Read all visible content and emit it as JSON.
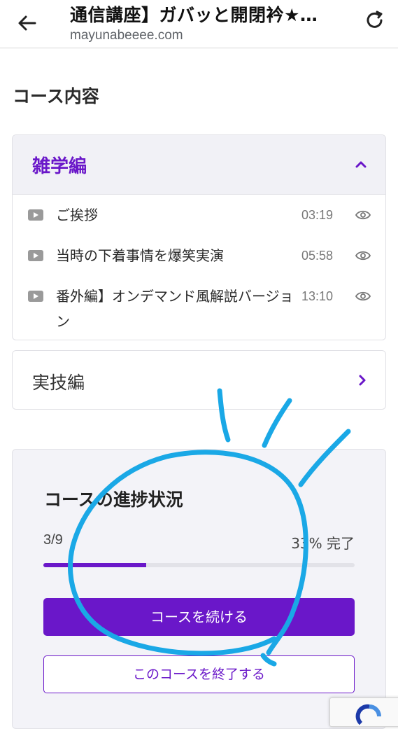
{
  "topbar": {
    "title": "通信講座】ガバッと開閉衿★…",
    "url": "mayunabeeee.com",
    "back_icon": "arrow-left-icon",
    "reload_icon": "reload-icon"
  },
  "content": {
    "heading": "コース内容",
    "sections": [
      {
        "title": "雑学編",
        "expanded": true,
        "lessons": [
          {
            "title": "ご挨拶",
            "time": "03:19"
          },
          {
            "title": "当時の下着事情を爆笑実演",
            "time": "05:58"
          },
          {
            "title": "番外編】オンデマンド風解説バージョン",
            "time": "13:10"
          }
        ]
      },
      {
        "title": "実技編",
        "expanded": false
      }
    ]
  },
  "progress": {
    "title": "コースの進捗状況",
    "count": "3/9",
    "percent_label": "33% 完了",
    "percent": 33,
    "continue_label": "コースを続ける",
    "finish_label": "このコースを終了する"
  },
  "colors": {
    "accent": "#6a17c9",
    "scribble": "#1aa8e6"
  }
}
